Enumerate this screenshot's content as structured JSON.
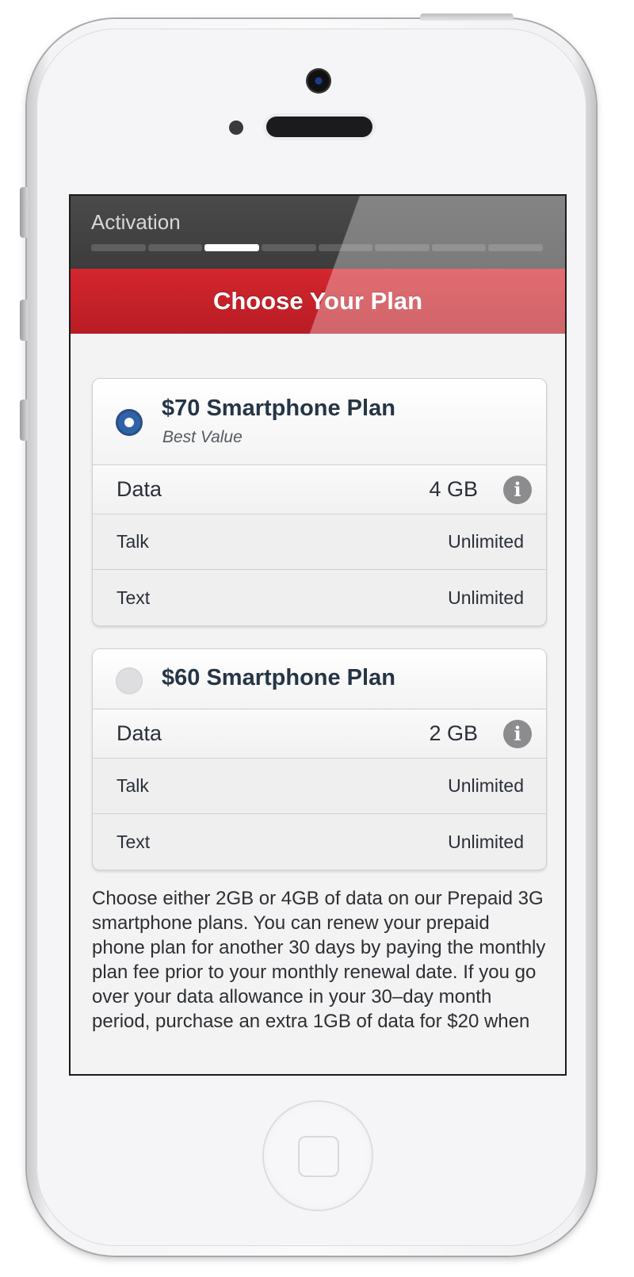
{
  "header": {
    "title": "Activation",
    "progress": {
      "total_steps": 8,
      "current_step": 3
    }
  },
  "page_title": "Choose Your Plan",
  "plans": [
    {
      "name": "$70 Smartphone Plan",
      "subtitle": "Best Value",
      "selected": true,
      "rows": [
        {
          "label": "Data",
          "value": "4 GB"
        },
        {
          "label": "Talk",
          "value": "Unlimited"
        },
        {
          "label": "Text",
          "value": "Unlimited"
        }
      ]
    },
    {
      "name": "$60 Smartphone Plan",
      "selected": false,
      "rows": [
        {
          "label": "Data",
          "value": "2 GB"
        },
        {
          "label": "Talk",
          "value": "Unlimited"
        },
        {
          "label": "Text",
          "value": "Unlimited"
        }
      ]
    }
  ],
  "info_icon_glyph": "i",
  "description": "Choose either 2GB or 4GB of data on our Prepaid 3G smartphone plans. You can renew your prepaid phone plan for another 30 days by paying the monthly plan fee prior to your monthly renewal date. If you go over your data allowance in your 30–day month period, purchase an extra 1GB of data for $20 when",
  "colors": {
    "header_bg": "#424242",
    "red_accent": "#c8222a",
    "radio_selected": "#2f63a6",
    "text_dark": "#263545"
  }
}
